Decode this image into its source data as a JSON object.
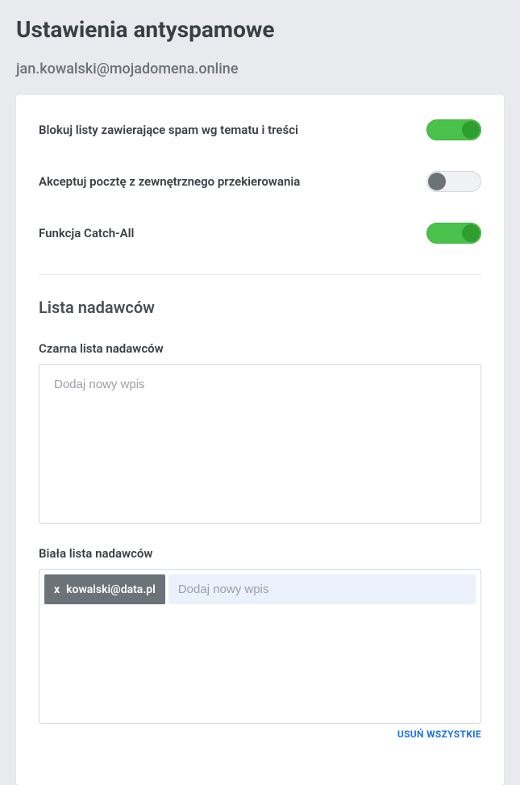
{
  "page": {
    "title": "Ustawienia antyspamowe",
    "email": "jan.kowalski@mojadomena.online"
  },
  "toggles": {
    "block_spam": {
      "label": "Blokuj listy zawierające spam wg tematu i treści",
      "enabled": true
    },
    "accept_forward": {
      "label": "Akceptuj pocztę z zewnętrznego przekierowania",
      "enabled": false
    },
    "catch_all": {
      "label": "Funkcja Catch-All",
      "enabled": true
    }
  },
  "senders": {
    "section_title": "Lista nadawców",
    "blacklist": {
      "label": "Czarna lista nadawców",
      "placeholder": "Dodaj nowy wpis",
      "entries": []
    },
    "whitelist": {
      "label": "Biała lista nadawców",
      "placeholder": "Dodaj nowy wpis",
      "entries": [
        "kowalski@data.pl"
      ],
      "delete_all": "USUŃ WSZYSTKIE"
    }
  }
}
